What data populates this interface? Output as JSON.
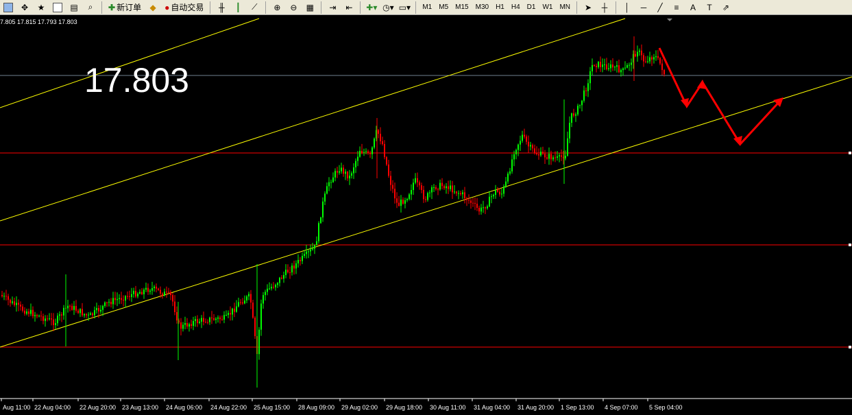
{
  "toolbar": {
    "new_order_label": "新订单",
    "auto_trade_label": "自动交易",
    "timeframes": [
      "M1",
      "M5",
      "M15",
      "M30",
      "H1",
      "H4",
      "D1",
      "W1",
      "MN"
    ],
    "tools_left": [
      "new-chart-icon",
      "profiles-icon",
      "market-watch-icon",
      "navigator-icon",
      "terminal-icon",
      "strategy-tester-icon"
    ],
    "chart_tools": [
      "bar-chart-icon",
      "candlestick-icon",
      "line-chart-icon",
      "zoom-in-icon",
      "zoom-out-icon",
      "tile-windows-icon",
      "auto-scroll-icon",
      "chart-shift-icon",
      "indicators-icon",
      "periodicity-icon",
      "templates-icon"
    ],
    "draw_tools": [
      "cursor-icon",
      "crosshair-icon",
      "vertical-line-icon",
      "horizontal-line-icon",
      "trendline-icon",
      "fibonacci-icon",
      "text-icon",
      "label-icon",
      "arrows-icon"
    ]
  },
  "ohlc_readout": "7.805 17.815 17.793 17.803",
  "price_display": "17.803",
  "colors": {
    "background": "#000000",
    "bull": "#00FF00",
    "bear": "#FF0000",
    "channel": "#FFFF00",
    "level": "#FF0000",
    "bid_line": "#708090",
    "projection": "#FF0000"
  },
  "chart_data": {
    "type": "candlestick",
    "symbol_price": 17.803,
    "x_tick_labels": [
      "Aug 11:00",
      "22 Aug 04:00",
      "22 Aug 20:00",
      "23 Aug 13:00",
      "24 Aug 06:00",
      "24 Aug 22:00",
      "25 Aug 15:00",
      "28 Aug 09:00",
      "29 Aug 02:00",
      "29 Aug 18:00",
      "30 Aug 11:00",
      "31 Aug 04:00",
      "31 Aug 20:00",
      "1 Sep 13:00",
      "4 Sep 07:00",
      "5 Sep 04:00"
    ],
    "y_range_estimate": [
      16.95,
      17.9
    ],
    "horizontal_levels": [
      17.6,
      17.38,
      17.13
    ],
    "annotations": [
      "ascending parallel channel (yellow)",
      "projected zig-zag path (red arrows)"
    ],
    "grid": false
  }
}
